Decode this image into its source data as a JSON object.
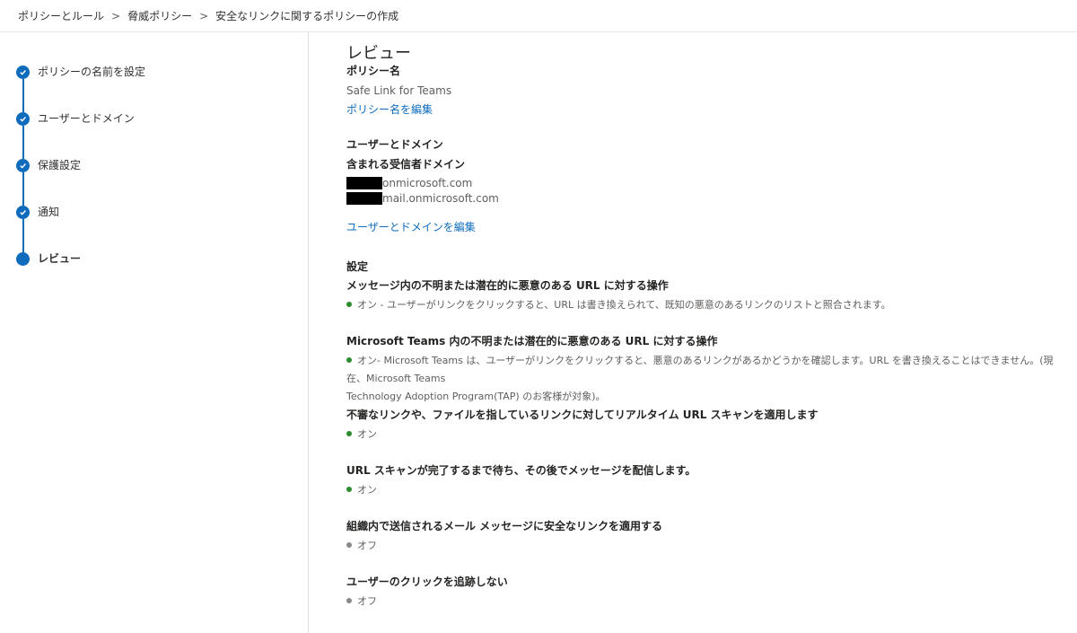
{
  "breadcrumb": [
    "ポリシーとルール",
    "脅威ポリシー",
    "安全なリンクに関するポリシーの作成"
  ],
  "breadcrumb_separator": ">",
  "steps": [
    {
      "label": "ポリシーの名前を設定",
      "state": "completed"
    },
    {
      "label": "ユーザーとドメイン",
      "state": "completed"
    },
    {
      "label": "保護設定",
      "state": "completed"
    },
    {
      "label": "通知",
      "state": "completed"
    },
    {
      "label": "レビュー",
      "state": "current"
    }
  ],
  "review": {
    "title": "レビュー",
    "policy_name_heading": "ポリシー名",
    "policy_name_value": "Safe Link for Teams",
    "edit_policy_name_link": "ポリシー名を編集",
    "users_domains_heading": "ユーザーとドメイン",
    "included_domains_heading": "含まれる受信者ドメイン",
    "domains": [
      "onmicrosoft.com",
      "mail.onmicrosoft.com"
    ],
    "edit_users_domains_link": "ユーザーとドメインを編集",
    "settings_heading": "設定",
    "settings": [
      {
        "label": "メッセージ内の不明または潜在的に悪意のある URL に対する操作",
        "status": "on",
        "text": "オン - ユーザーがリンクをクリックすると、URL は書き換えられて、既知の悪意のあるリンクのリストと照合されます。"
      },
      {
        "label": "Microsoft Teams 内の不明または潜在的に悪意のある URL に対する操作",
        "status": "on",
        "text": "オン- Microsoft Teams は、ユーザーがリンクをクリックすると、悪意のあるリンクがあるかどうかを確認します。URL を書き換えることはできません。(現在、Microsoft Teams",
        "text2": "Technology Adoption Program(TAP) のお客様が対象)。"
      },
      {
        "label": "不審なリンクや、ファイルを指しているリンクに対してリアルタイム URL スキャンを適用します",
        "status": "on",
        "text": "オン"
      },
      {
        "label": "URL スキャンが完了するまで待ち、その後でメッセージを配信します。",
        "status": "on",
        "text": "オン"
      },
      {
        "label": "組織内で送信されるメール メッセージに安全なリンクを適用する",
        "status": "off",
        "text": "オフ"
      },
      {
        "label": "ユーザーのクリックを追跡しない",
        "status": "off",
        "text": "オフ"
      }
    ]
  },
  "colors": {
    "accent": "#0f6cbd",
    "on": "#2e8b2e",
    "off": "#8a8886"
  }
}
